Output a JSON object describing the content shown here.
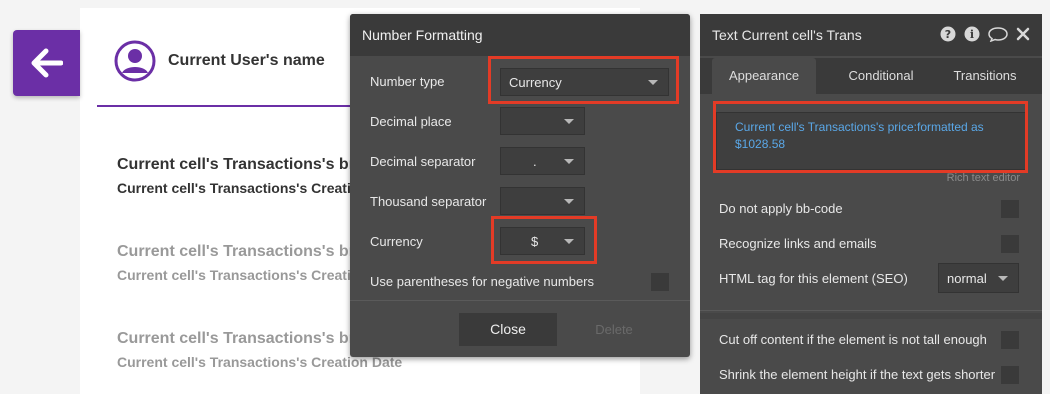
{
  "canvas": {
    "user_name": "Current User's name",
    "transactions": [
      {
        "title": "Current cell's Transactions's bran",
        "subtitle": "Current cell's Transactions's Creation"
      },
      {
        "title": "Current cell's Transactions's bran",
        "subtitle": "Current cell's Transactions's Creation"
      },
      {
        "title": "Current cell's Transactions's bran",
        "subtitle": "Current cell's Transactions's Creation Date"
      }
    ],
    "accent_color": "#6b2fa6"
  },
  "number_formatting": {
    "title": "Number Formatting",
    "number_type_label": "Number type",
    "number_type_value": "Currency",
    "decimal_place_label": "Decimal place",
    "decimal_place_value": "",
    "decimal_separator_label": "Decimal separator",
    "decimal_separator_value": ".",
    "thousand_separator_label": "Thousand separator",
    "thousand_separator_value": "",
    "currency_label": "Currency",
    "currency_value": "$",
    "parentheses_label": "Use parentheses for negative numbers",
    "close_label": "Close",
    "delete_label": "Delete",
    "highlight_color": "#e33b26"
  },
  "properties": {
    "title": "Text Current cell's Trans",
    "icons": [
      "help-icon",
      "info-icon",
      "comment-icon",
      "close-icon"
    ],
    "tabs": [
      "Appearance",
      "Conditional",
      "Transitions"
    ],
    "active_tab": "Appearance",
    "expression": "Current cell's Transactions's price:formatted as $1028.58",
    "rich_text_editor_label": "Rich text editor",
    "do_not_apply_bbcode_label": "Do not apply bb-code",
    "recognize_links_label": "Recognize links and emails",
    "html_tag_label": "HTML tag for this element (SEO)",
    "html_tag_value": "normal",
    "cut_off_label": "Cut off content if the element is not tall enough",
    "shrink_label": "Shrink the element height if the text gets shorter",
    "expression_color": "#5aa8e8"
  }
}
